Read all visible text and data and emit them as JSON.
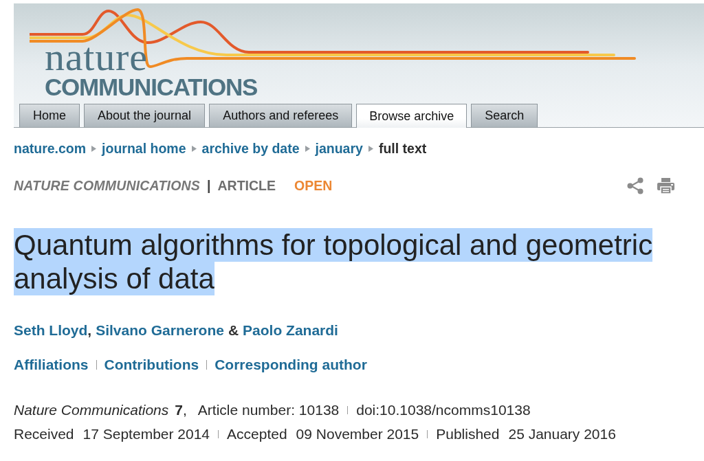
{
  "header": {
    "logo": {
      "line_1": "nature",
      "line_2": "COMMUNICATIONS"
    },
    "tabs": [
      {
        "label": "Home",
        "selected": false
      },
      {
        "label": "About the journal",
        "selected": false
      },
      {
        "label": "Authors and referees",
        "selected": false
      },
      {
        "label": "Browse archive",
        "selected": true
      },
      {
        "label": "Search",
        "selected": false
      }
    ]
  },
  "breadcrumb": [
    {
      "label": "nature.com",
      "kind": "link"
    },
    {
      "label": "journal home",
      "kind": "link"
    },
    {
      "label": "archive by date",
      "kind": "link"
    },
    {
      "label": "january",
      "kind": "link"
    },
    {
      "label": "full text",
      "kind": "current"
    }
  ],
  "article_type": {
    "journal": "NATURE COMMUNICATIONS",
    "separator": "|",
    "type": "ARTICLE",
    "access": "OPEN"
  },
  "title": {
    "text": "Quantum algorithms for topological and geometric analysis of data",
    "highlighted": true
  },
  "authors": [
    {
      "name": "Seth Lloyd",
      "separator": {
        "kind": "comma",
        "text": ","
      }
    },
    {
      "name": "Silvano Garnerone",
      "separator": {
        "kind": "ampersand",
        "text": "&"
      }
    },
    {
      "name": "Paolo Zanardi"
    }
  ],
  "article_links": [
    "Affiliations",
    "Contributions",
    "Corresponding author"
  ],
  "citation": {
    "journal": "Nature Communications",
    "volume": "**7**,",
    "article_number": "Article number: 10138",
    "doi": "doi:10.1038/ncomms10138"
  },
  "history": [
    {
      "label": "Received",
      "date": "17 September 2014"
    },
    {
      "label": "Accepted",
      "date": "09 November 2015"
    },
    {
      "label": "Published",
      "date": "25 January 2016"
    }
  ]
}
